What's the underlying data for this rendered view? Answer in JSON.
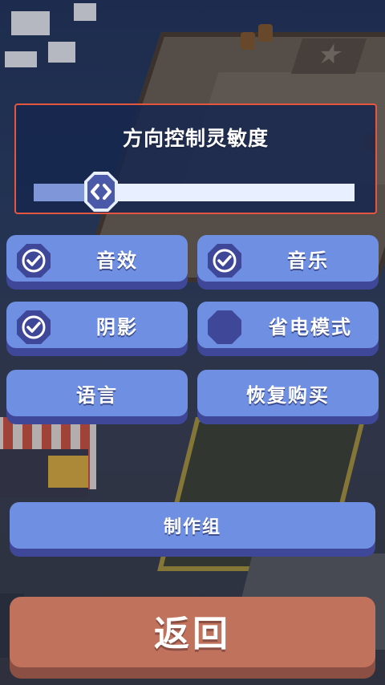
{
  "sensitivity": {
    "title": "方向控制灵敏度",
    "value_fraction": 0.21
  },
  "settings": {
    "sound_effects": {
      "label": "音效",
      "checked": true
    },
    "music": {
      "label": "音乐",
      "checked": true
    },
    "shadows": {
      "label": "阴影",
      "checked": true
    },
    "power_saving": {
      "label": "省电模式",
      "checked": false
    },
    "language": {
      "label": "语言"
    },
    "restore_purchase": {
      "label": "恢复购买"
    },
    "credits": {
      "label": "制作组"
    },
    "back": {
      "label": "返回"
    }
  },
  "colors": {
    "button_face": "#6f8fe3",
    "button_base": "#3f4798",
    "checkbox": "#3f4798",
    "back_face": "#c0725c",
    "highlight_border": "#e5563f"
  },
  "icons": {
    "checked": "check-circle-icon",
    "unchecked": "empty-octagon-icon",
    "slider_thumb": "left-right-arrows-icon"
  }
}
